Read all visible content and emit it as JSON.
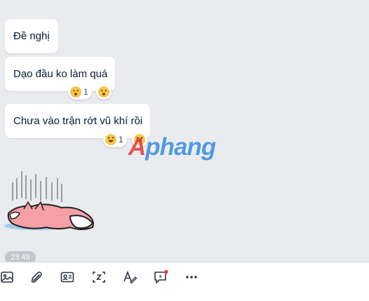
{
  "messages": [
    {
      "text": "Đề nghị"
    },
    {
      "text": "Dạo đầu ko làm quá",
      "reaction": {
        "emoji": "surprised-face",
        "count": "1"
      }
    },
    {
      "text": "Chưa vào trận rớt vũ khí rồi",
      "reaction": {
        "emoji": "laughing-face",
        "count": "1"
      }
    }
  ],
  "sticker": {
    "name": "fallen-fox-sticker"
  },
  "timestamp": "23:48",
  "watermark": {
    "prefix": "A",
    "rest": "phang"
  },
  "toolbar": {
    "icons": [
      "image-icon",
      "attachment-icon",
      "contact-card-icon",
      "screenshot-icon",
      "text-format-icon",
      "quick-message-icon",
      "more-icon"
    ],
    "quick_message_dot_color": "#e53935"
  },
  "colors": {
    "chat_background": "#e9ebee",
    "bubble": "#ffffff",
    "text": "#081c36"
  }
}
